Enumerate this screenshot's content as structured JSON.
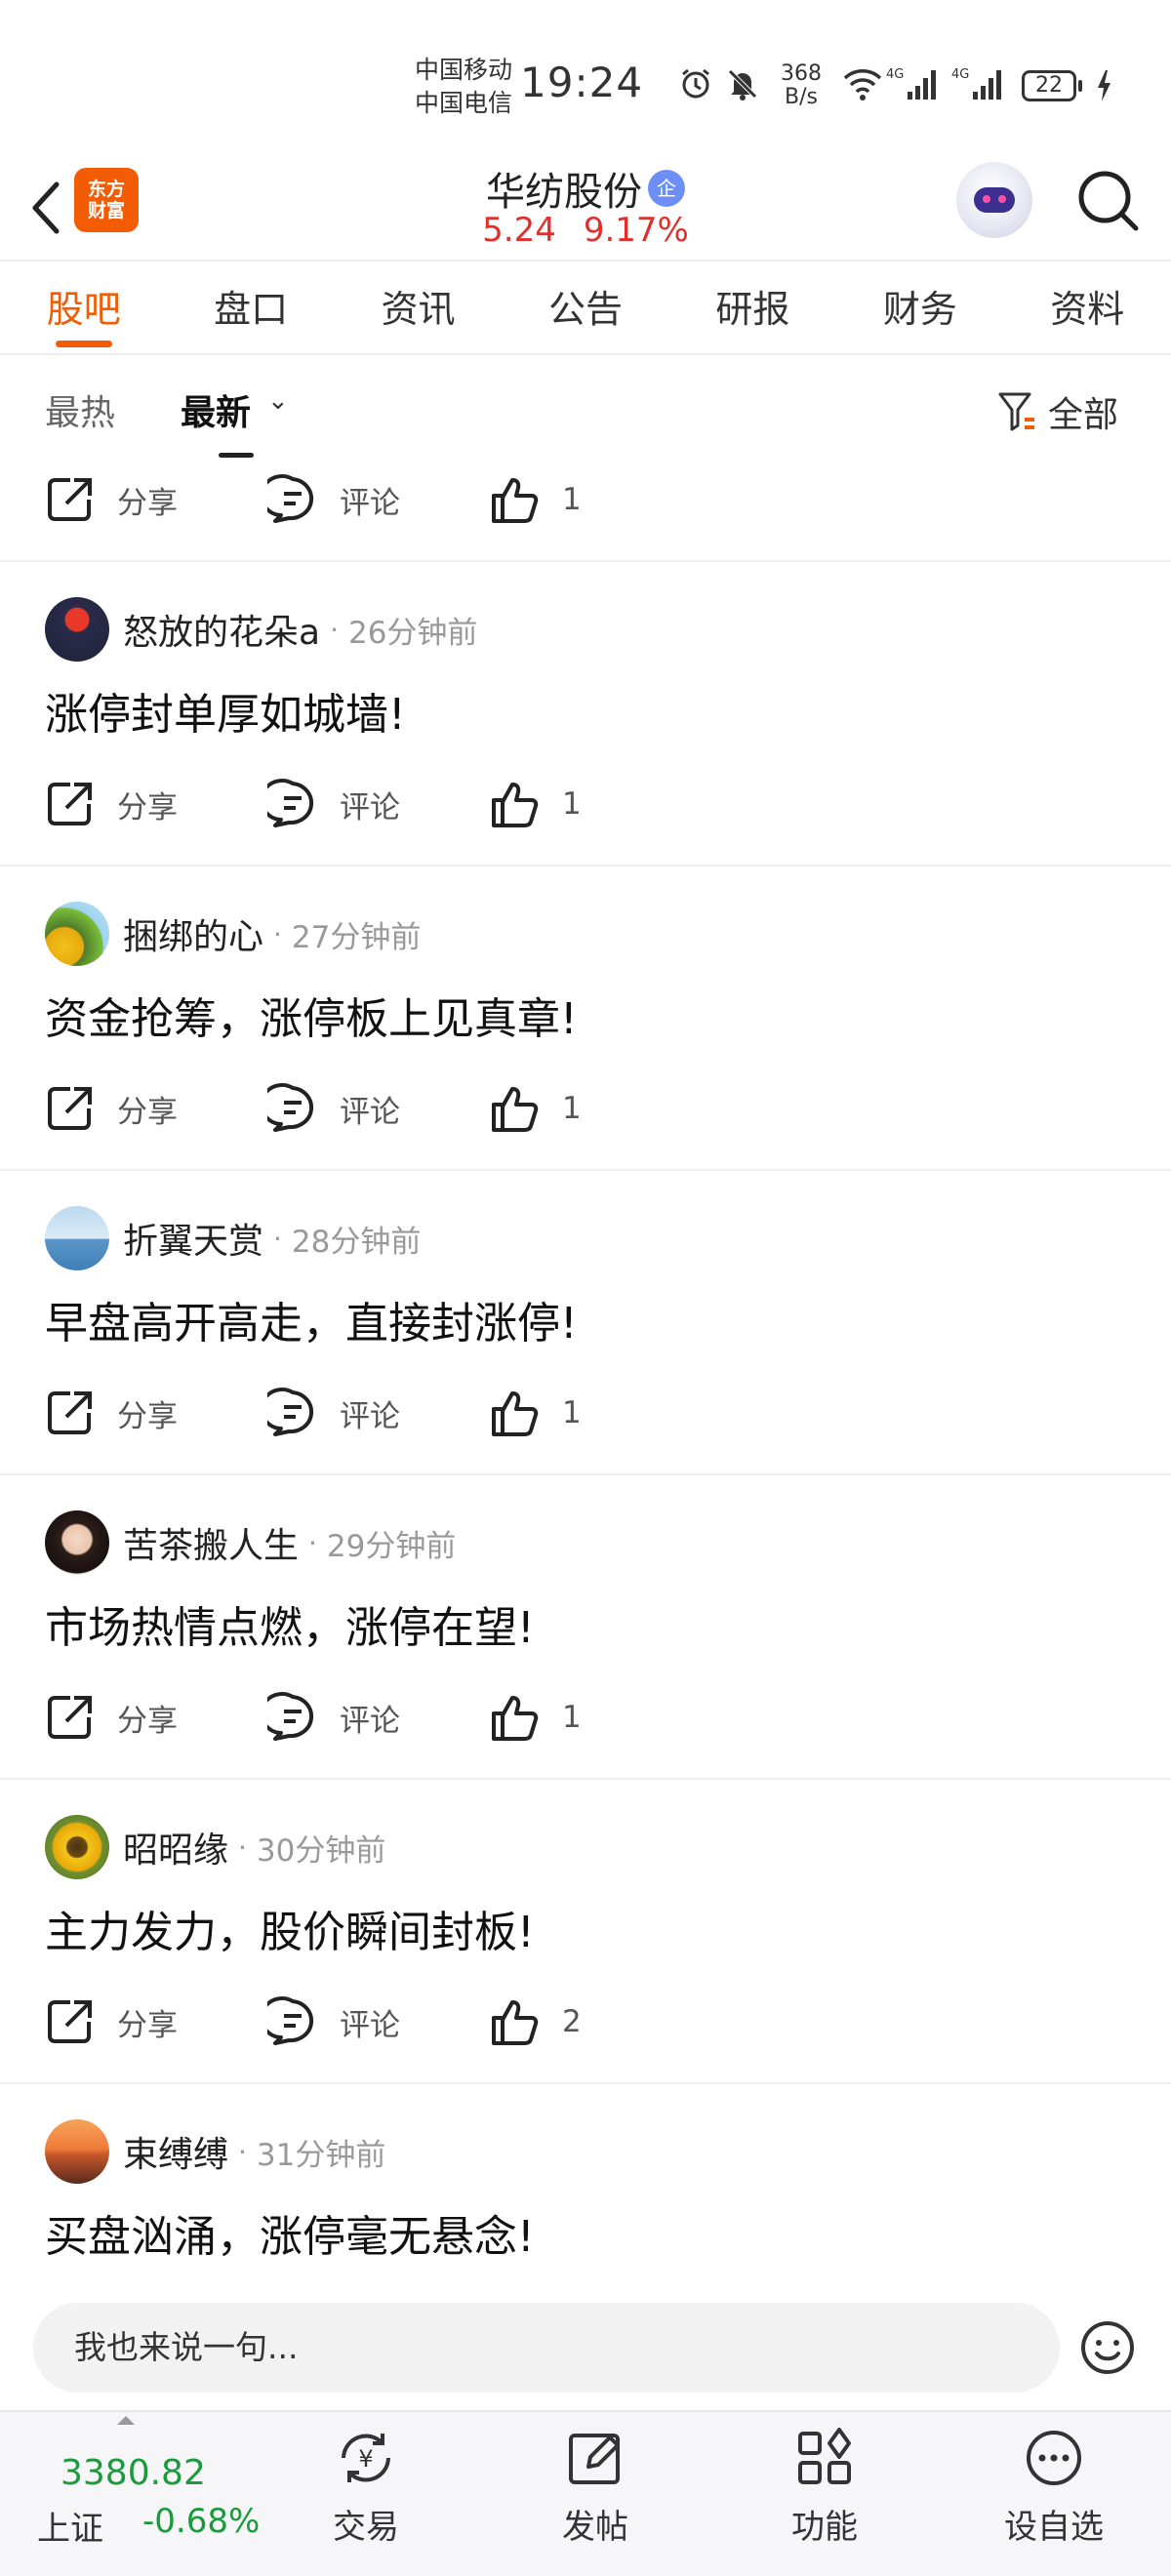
{
  "status_bar": {
    "carrier_1": "中国移动",
    "carrier_2": "中国电信",
    "time": "19:24",
    "net_speed_value": "368",
    "net_speed_unit": "B/s",
    "battery": "22"
  },
  "header": {
    "app_logo_line1": "东方",
    "app_logo_line2": "财富",
    "stock_name": "华纺股份",
    "verified_badge": "企",
    "price": "5.24",
    "change_percent": "9.17%"
  },
  "tabs": [
    {
      "label": "股吧",
      "active": true
    },
    {
      "label": "盘口"
    },
    {
      "label": "资讯"
    },
    {
      "label": "公告"
    },
    {
      "label": "研报"
    },
    {
      "label": "财务"
    },
    {
      "label": "资料"
    }
  ],
  "filter": {
    "hot": "最热",
    "new": "最新",
    "new_caret": "⌄",
    "all": "全部"
  },
  "action_labels": {
    "share": "分享",
    "comment": "评论"
  },
  "first_post_likes": "1",
  "posts": [
    {
      "user": "怒放的花朵a",
      "time": "26分钟前",
      "text": "涨停封单厚如城墙!",
      "likes": "1"
    },
    {
      "user": "捆绑的心",
      "time": "27分钟前",
      "text": "资金抢筹，涨停板上见真章!",
      "likes": "1"
    },
    {
      "user": "折翼天赏",
      "time": "28分钟前",
      "text": "早盘高开高走，直接封涨停!",
      "likes": "1"
    },
    {
      "user": "苦茶搬人生",
      "time": "29分钟前",
      "text": "市场热情点燃，涨停在望!",
      "likes": "1"
    },
    {
      "user": "昭昭缘",
      "time": "30分钟前",
      "text": "主力发力，股价瞬间封板!",
      "likes": "2"
    },
    {
      "user": "束缚缚",
      "time": "31分钟前",
      "text": "买盘汹涌，涨停毫无悬念!",
      "likes": ""
    }
  ],
  "separator": "·",
  "input": {
    "placeholder": "我也来说一句..."
  },
  "bottom_bar": {
    "index_value": "3380.82",
    "index_name": "上证",
    "index_change": "-0.68%",
    "nav": [
      {
        "label": "交易",
        "icon": "trade-icon"
      },
      {
        "label": "发帖",
        "icon": "compose-icon"
      },
      {
        "label": "功能",
        "icon": "apps-icon"
      },
      {
        "label": "设自选",
        "icon": "more-icon"
      }
    ]
  },
  "colors": {
    "accent": "#f25c05",
    "up": "#e0302c",
    "down": "#1a9a3c"
  }
}
